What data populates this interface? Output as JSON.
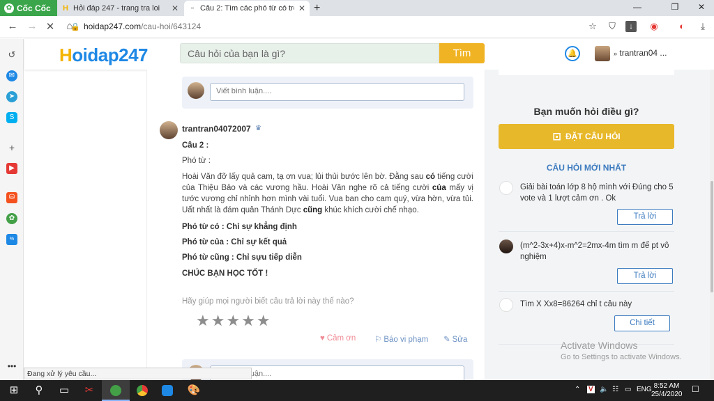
{
  "browser": {
    "brand": "Cốc Cốc",
    "tabs": [
      {
        "title": "Hỏi đáp 247 - trang tra loi"
      },
      {
        "title": "Câu 2: Tìm các phó từ có tron"
      }
    ],
    "url_host": "hoidap247.com",
    "url_path": "/cau-hoi/643124",
    "status_text": "Đang xử lý yêu cầu..."
  },
  "site": {
    "logo_h": "H",
    "logo_rest": "oidap247",
    "search_placeholder": "Câu hỏi của bạn là gì?",
    "search_button": "Tìm",
    "username": "trantran04 ..."
  },
  "comment": {
    "placeholder": "Viết bình luận...."
  },
  "answer": {
    "username": "trantran04072007",
    "heading": "Câu 2 :",
    "subheading": "Phó từ :",
    "para_1": "Hoài Văn đỡ lấy quả cam, tạ ơn vua; lủi thủi bước lên bờ. Đằng sau ",
    "word_1": "có",
    "para_2": " tiếng cười của Thiệu Bảo và các vương hầu. Hoài Văn nghe rõ cả tiếng cười ",
    "word_2": "của",
    "para_3": " mấy vị tước vương chỉ nhỉnh hơn mình vài tuổi. Vua ban cho cam quý, vừa hờn, vừa tủi. Uất nhất là đám quân Thánh Dực ",
    "word_3": "cũng",
    "para_4": " khúc khích cười chế nhạo.",
    "line_co": "Phó từ có : Chỉ sự khẳng định",
    "line_cua": "Phó từ của : Chỉ sự kết quả",
    "line_cung": "Phó từ cũng : Chỉ sựu tiếp diễn",
    "closing": "CHÚC BẠN HỌC TỐT !",
    "help_text": "Hãy giúp mọi người biết câu trả lời này thế nào?",
    "stars": "★★★★★",
    "thanks": "Cảm ơn",
    "report": "Báo vi phạm",
    "edit": "Sửa"
  },
  "sidebar": {
    "ask_title": "Bạn muốn hỏi điều gì?",
    "ask_button": "ĐẶT CÂU HỎI",
    "new_title": "CÂU HỎI MỚI NHẤT",
    "questions": [
      {
        "text": "Giải bài toán lớp 8 hộ mình với Đúng cho 5 vote và 1 lượt cảm ơn . Ok",
        "button": "Trả lời"
      },
      {
        "text": "(m^2-3x+4)x-m^2=2mx-4m tìm m để pt vô nghiệm",
        "button": "Trả lời"
      },
      {
        "text": "Tìm X Xx8=86264 chỉ t câu này",
        "button": "Chi tiết"
      }
    ],
    "activate_1": "Activate Windows",
    "activate_2": "Go to Settings to activate Windows."
  },
  "taskbar": {
    "lang": "ENG",
    "time": "8:52 AM",
    "date": "25/4/2020"
  },
  "colors": {
    "brand_blue": "#1e88e5",
    "search_yellow": "#f0b323",
    "ask_yellow": "#e8b82b",
    "link_blue": "#3d7bbf"
  }
}
